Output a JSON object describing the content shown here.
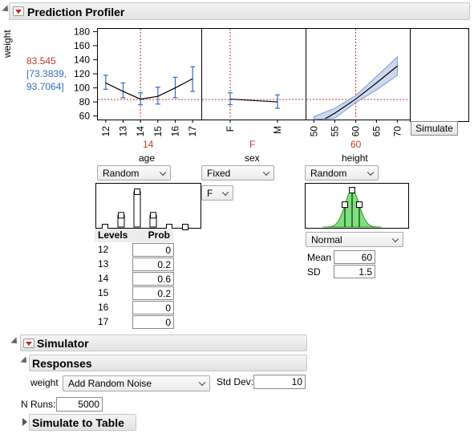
{
  "profiler": {
    "title": "Prediction Profiler",
    "response": {
      "name": "weight",
      "predicted": "83.545",
      "ci_low": "[73.3839,",
      "ci_high": "93.7064]"
    },
    "y_ticks": [
      "180",
      "160",
      "140",
      "120",
      "100",
      "80",
      "60"
    ],
    "factors": [
      {
        "name": "age",
        "current": "14",
        "ticks": [
          "12",
          "13",
          "14",
          "15",
          "16",
          "17"
        ],
        "mode": "Random"
      },
      {
        "name": "sex",
        "current": "F",
        "ticks": [
          "F",
          "M"
        ],
        "mode": "Fixed",
        "fixed_value": "F"
      },
      {
        "name": "height",
        "current": "60",
        "ticks": [
          "50",
          "55",
          "60",
          "65",
          "70"
        ],
        "mode": "Random",
        "distribution": "Normal"
      }
    ],
    "simulate_button": "Simulate"
  },
  "age_random": {
    "levels_header": "Levels",
    "prob_header": "Prob",
    "rows": [
      {
        "level": "12",
        "prob": "0"
      },
      {
        "level": "13",
        "prob": "0.2"
      },
      {
        "level": "14",
        "prob": "0.6"
      },
      {
        "level": "15",
        "prob": "0.2"
      },
      {
        "level": "16",
        "prob": "0"
      },
      {
        "level": "17",
        "prob": "0"
      }
    ]
  },
  "height_random": {
    "mean_label": "Mean",
    "mean_value": "60",
    "sd_label": "SD",
    "sd_value": "1.5"
  },
  "simulator": {
    "title": "Simulator",
    "responses_title": "Responses",
    "response_name": "weight",
    "noise_option": "Add Random Noise",
    "std_dev_label": "Std Dev:",
    "std_dev_value": "10",
    "n_runs_label": "N Runs:",
    "n_runs_value": "5000",
    "simulate_to_table": "Simulate to Table"
  },
  "chart_data": [
    {
      "type": "line",
      "title": "",
      "xlabel": "age",
      "ylabel": "weight",
      "x": [
        12,
        13,
        14,
        15,
        16,
        17
      ],
      "y": [
        107,
        95,
        84,
        88,
        100,
        113
      ],
      "ci_low": [
        98,
        86,
        76,
        77,
        86,
        95
      ],
      "ci_high": [
        118,
        107,
        93,
        101,
        115,
        130
      ],
      "ylim": [
        55,
        185
      ],
      "xlim": [
        11.5,
        17.5
      ],
      "current_x": 14,
      "reference_y": 83.545
    },
    {
      "type": "line",
      "title": "",
      "xlabel": "sex",
      "ylabel": "weight",
      "x": [
        "F",
        "M"
      ],
      "y": [
        84,
        80
      ],
      "ci_low": [
        76,
        71
      ],
      "ci_high": [
        93,
        90
      ],
      "ylim": [
        55,
        185
      ],
      "current_x": "F",
      "reference_y": 83.545
    },
    {
      "type": "line",
      "title": "",
      "xlabel": "height",
      "ylabel": "weight",
      "x": [
        50,
        55,
        60,
        65,
        70
      ],
      "y": [
        47,
        64,
        84,
        107,
        131
      ],
      "band_low": [
        35,
        57,
        79,
        97,
        118
      ],
      "band_high": [
        59,
        71,
        89,
        116,
        144
      ],
      "ylim": [
        55,
        185
      ],
      "xlim": [
        48,
        73
      ],
      "current_x": 60,
      "reference_y": 83.545
    }
  ]
}
